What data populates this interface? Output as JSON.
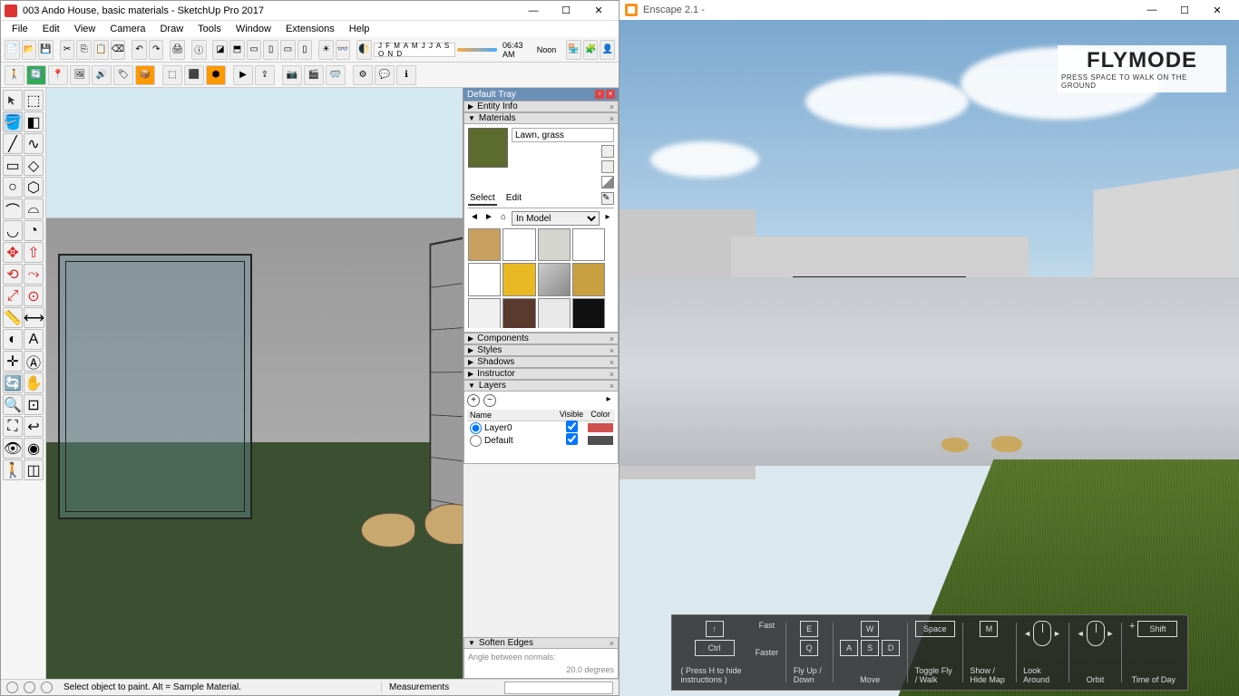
{
  "sketchup": {
    "title": "003 Ando House, basic materials - SketchUp Pro 2017",
    "menu": [
      "File",
      "Edit",
      "View",
      "Camera",
      "Draw",
      "Tools",
      "Window",
      "Extensions",
      "Help"
    ],
    "months": "J F M A M J J A S O N D",
    "time": "06:43 AM",
    "noon": "Noon",
    "status": {
      "hint": "Select object to paint. Alt = Sample Material.",
      "measurements_label": "Measurements"
    }
  },
  "tray": {
    "title": "Default Tray",
    "panels": {
      "entity_info": "Entity Info",
      "materials": "Materials",
      "components": "Components",
      "styles": "Styles",
      "shadows": "Shadows",
      "instructor": "Instructor",
      "layers": "Layers",
      "soften": "Soften Edges"
    },
    "material": {
      "name": "Lawn, grass",
      "tabs": {
        "select": "Select",
        "edit": "Edit"
      },
      "library": "In Model",
      "swatches": [
        "#c9a060",
        "#ffffff",
        "#d5d5d0",
        "#ffffff",
        "#ffffff",
        "#e8b923",
        "#a8a8a8",
        "#c9a040",
        "#f0f0f0",
        "#5a3a2e",
        "#e8e8e8",
        "#111111",
        "#d0d0d0",
        "#888888",
        "#c08040",
        "#606060"
      ]
    },
    "layers": {
      "cols": {
        "name": "Name",
        "visible": "Visible",
        "color": "Color"
      },
      "rows": [
        {
          "name": "Layer0",
          "visible": true,
          "color": "#d05050",
          "active": true
        },
        {
          "name": "Default",
          "visible": true,
          "color": "#505050",
          "active": false
        }
      ]
    },
    "soften": {
      "label": "Angle between normals:",
      "value": "20.0",
      "unit": "degrees"
    }
  },
  "enscape": {
    "title": "Enscape 2.1 -",
    "flymode": {
      "big": "FLYMODE",
      "small": "PRESS SPACE TO WALK ON THE GROUND"
    },
    "controls": {
      "hide": "( Press H to hide instructions )",
      "fast": "Fast",
      "faster": "Faster",
      "flyupdown": "Fly Up / Down",
      "move": "Move",
      "toggle": "Toggle Fly / Walk",
      "map": "Show / Hide Map",
      "look": "Look Around",
      "orbit": "Orbit",
      "tod": "Time of Day",
      "keys": {
        "up": "↑",
        "ctrl": "Ctrl",
        "e": "E",
        "q": "Q",
        "w": "W",
        "a": "A",
        "s": "S",
        "d": "D",
        "space": "Space",
        "m": "M",
        "shift": "Shift",
        "plus": "+"
      }
    }
  }
}
